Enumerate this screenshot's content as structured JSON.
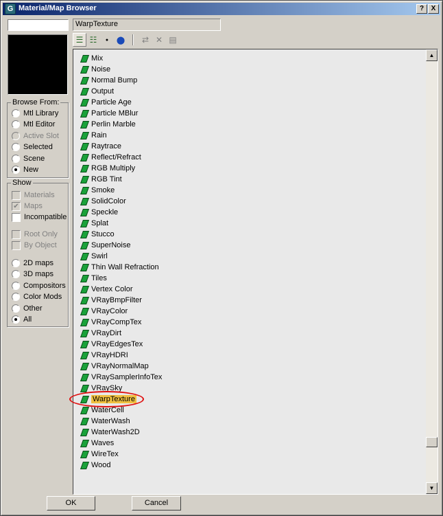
{
  "window": {
    "title": "Material/Map Browser"
  },
  "title_buttons": {
    "help": "?",
    "close": "X"
  },
  "name_field": {
    "value": "WarpTexture"
  },
  "browse_from": {
    "title": "Browse From:",
    "options": [
      {
        "label": "Mtl Library",
        "selected": false,
        "disabled": false
      },
      {
        "label": "Mtl Editor",
        "selected": false,
        "disabled": false
      },
      {
        "label": "Active Slot",
        "selected": false,
        "disabled": true
      },
      {
        "label": "Selected",
        "selected": false,
        "disabled": false
      },
      {
        "label": "Scene",
        "selected": false,
        "disabled": false
      },
      {
        "label": "New",
        "selected": true,
        "disabled": false
      }
    ]
  },
  "show": {
    "title": "Show",
    "checks": [
      {
        "label": "Materials",
        "checked": false,
        "disabled": true
      },
      {
        "label": "Maps",
        "checked": true,
        "disabled": true
      },
      {
        "label": "Incompatible",
        "checked": false,
        "disabled": false
      }
    ],
    "checks2": [
      {
        "label": "Root Only",
        "checked": false,
        "disabled": true
      },
      {
        "label": "By Object",
        "checked": false,
        "disabled": true
      }
    ],
    "radios": [
      {
        "label": "2D maps",
        "selected": false
      },
      {
        "label": "3D maps",
        "selected": false
      },
      {
        "label": "Compositors",
        "selected": false
      },
      {
        "label": "Color Mods",
        "selected": false
      },
      {
        "label": "Other",
        "selected": false
      },
      {
        "label": "All",
        "selected": true
      }
    ]
  },
  "toolbar": {
    "tools": [
      {
        "name": "view-list-icon",
        "glyph": "☰",
        "active": true,
        "disabled": false
      },
      {
        "name": "view-list-icons-icon",
        "glyph": "☷",
        "active": false,
        "disabled": false
      },
      {
        "name": "view-small-icons-icon",
        "glyph": "●",
        "active": false,
        "disabled": false
      },
      {
        "name": "view-large-icons-icon",
        "glyph": "⬤",
        "active": false,
        "disabled": false
      },
      {
        "name": "update-scene-materials-icon",
        "glyph": "⇄",
        "active": false,
        "disabled": true
      },
      {
        "name": "delete-icon",
        "glyph": "✕",
        "active": false,
        "disabled": true
      },
      {
        "name": "clear-library-icon",
        "glyph": "▤",
        "active": false,
        "disabled": true
      }
    ]
  },
  "map_list": {
    "items": [
      "Mix",
      "Noise",
      "Normal Bump",
      "Output",
      "Particle Age",
      "Particle MBlur",
      "Perlin Marble",
      "Rain",
      "Raytrace",
      "Reflect/Refract",
      "RGB Multiply",
      "RGB Tint",
      "Smoke",
      "SolidColor",
      "Speckle",
      "Splat",
      "Stucco",
      "SuperNoise",
      "Swirl",
      "Thin Wall Refraction",
      "Tiles",
      "Vertex Color",
      "VRayBmpFilter",
      "VRayColor",
      "VRayCompTex",
      "VRayDirt",
      "VRayEdgesTex",
      "VRayHDRI",
      "VRayNormalMap",
      "VRaySamplerInfoTex",
      "VRaySky",
      "WarpTexture",
      "WaterCell",
      "WaterWash",
      "WaterWash2D",
      "Waves",
      "WireTex",
      "Wood"
    ],
    "selected": "WarpTexture"
  },
  "buttons": {
    "ok": "OK",
    "cancel": "Cancel"
  }
}
